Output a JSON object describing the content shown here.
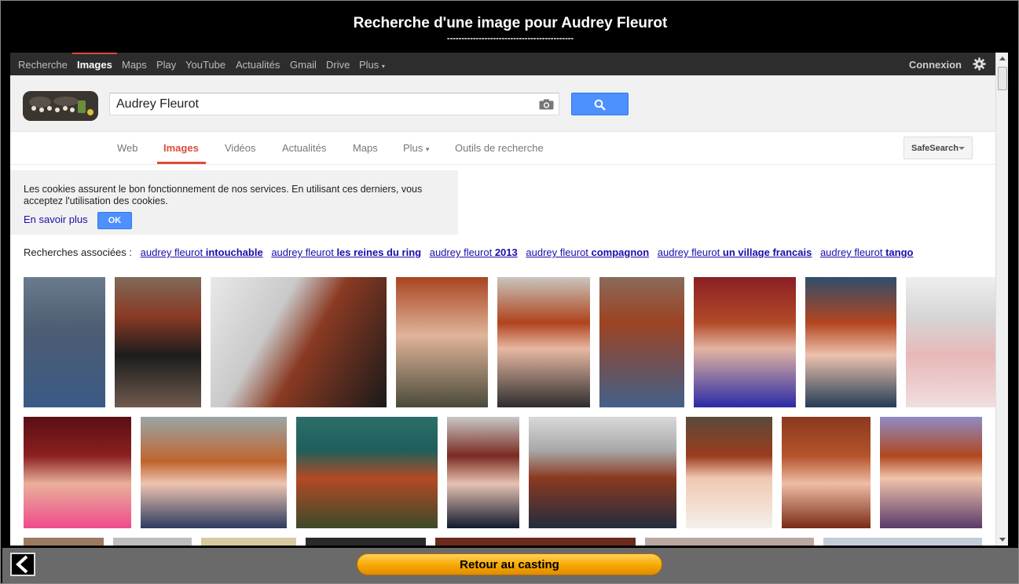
{
  "window": {
    "title": "Recherche d'une image pour Audrey Fleurot",
    "title_underline": "--------------------------------------------"
  },
  "gbar": {
    "items": [
      "Recherche",
      "Images",
      "Maps",
      "Play",
      "YouTube",
      "Actualités",
      "Gmail",
      "Drive",
      "Plus"
    ],
    "active": "Images",
    "signin": "Connexion",
    "settings_icon": "gear-icon"
  },
  "search": {
    "value": "Audrey Fleurot",
    "camera_icon": "camera-icon",
    "button_icon": "search-icon"
  },
  "tabs": {
    "items": [
      "Web",
      "Images",
      "Vidéos",
      "Actualités",
      "Maps",
      "Plus",
      "Outils de recherche"
    ],
    "active": "Images",
    "safesearch": "SafeSearch"
  },
  "cookie": {
    "text": "Les cookies assurent le bon fonctionnement de nos services. En utilisant ces derniers, vous acceptez l'utilisation des cookies.",
    "more": "En savoir plus",
    "ok": "OK"
  },
  "related": {
    "label": "Recherches associées :",
    "items": [
      {
        "prefix": "audrey fleurot ",
        "bold": "intouchable"
      },
      {
        "prefix": "audrey fleurot ",
        "bold": "les reines du ring"
      },
      {
        "prefix": "audrey fleurot ",
        "bold": "2013"
      },
      {
        "prefix": "audrey fleurot ",
        "bold": "compagnon"
      },
      {
        "prefix": "audrey fleurot ",
        "bold": "un village francais"
      },
      {
        "prefix": "audrey fleurot ",
        "bold": "tango"
      }
    ]
  },
  "footer": {
    "casting_button": "Retour au casting",
    "back_icon": "back-arrow-icon"
  },
  "colors": {
    "accent_red": "#dd4b39",
    "search_blue": "#4d90fe",
    "link_blue": "#1a0dab",
    "casting_orange": "#f7a800"
  }
}
